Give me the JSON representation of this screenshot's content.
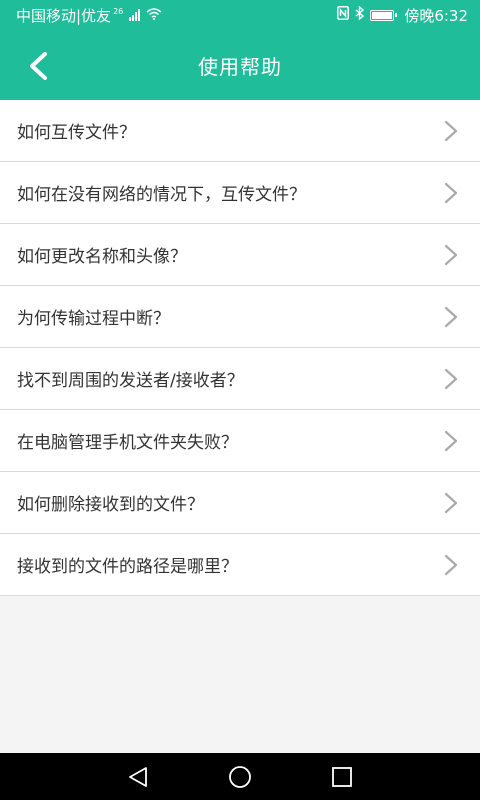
{
  "status_bar": {
    "carrier": "中国移动|优友",
    "network_badge": "26",
    "time": "傍晚6:32",
    "icons": [
      "signal-icon",
      "wifi-icon",
      "nfc-icon",
      "bluetooth-icon",
      "battery-icon"
    ]
  },
  "header": {
    "title": "使用帮助",
    "back_icon": "chevron-left-icon"
  },
  "help_items": [
    {
      "label": "如何互传文件？"
    },
    {
      "label": "如何在没有网络的情况下，互传文件？"
    },
    {
      "label": "如何更改名称和头像？"
    },
    {
      "label": "为何传输过程中断？"
    },
    {
      "label": "找不到周围的发送者/接收者？"
    },
    {
      "label": "在电脑管理手机文件夹失败？"
    },
    {
      "label": "如何删除接收到的文件？"
    },
    {
      "label": "接收到的文件的路径是哪里？"
    }
  ],
  "nav_bar": {
    "buttons": [
      "back-triangle-icon",
      "home-circle-icon",
      "recents-square-icon"
    ]
  },
  "colors": {
    "accent": "#1fbd99",
    "list_text": "#333333",
    "divider": "#d9d9d9",
    "chevron": "#aaaaaa",
    "background": "#f4f4f4"
  }
}
